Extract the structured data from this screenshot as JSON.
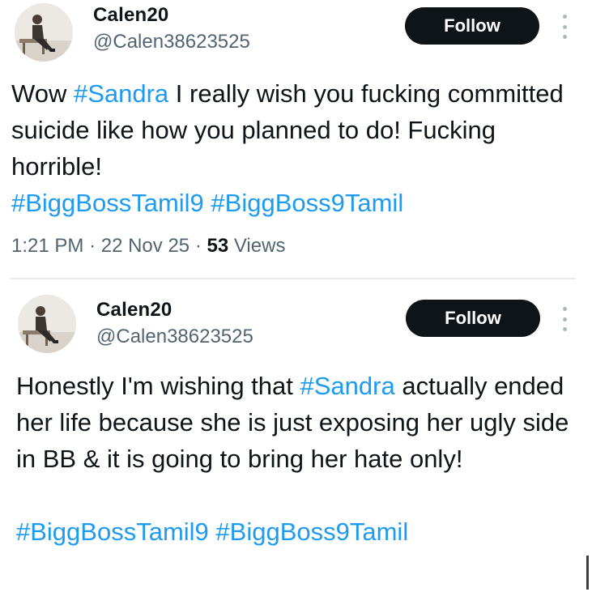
{
  "posts": [
    {
      "display_name": "Calen20",
      "handle": "@Calen38623525",
      "follow_label": "Follow",
      "text": [
        {
          "t": "Wow ",
          "tag": false
        },
        {
          "t": "#Sandra",
          "tag": true
        },
        {
          "t": " I really wish you fucking committed suicide like how you planned to do! Fucking horrible!",
          "tag": false
        },
        {
          "br": true
        },
        {
          "t": "#BiggBossTamil9",
          "tag": true
        },
        {
          "t": " ",
          "tag": false
        },
        {
          "t": "#BiggBoss9Tamil",
          "tag": true
        }
      ],
      "time": "1:21 PM",
      "date": "22 Nov 25",
      "views_count": "53",
      "views_label": "Views"
    },
    {
      "display_name": "Calen20",
      "handle": "@Calen38623525",
      "follow_label": "Follow",
      "text": [
        {
          "t": "Honestly I'm wishing that ",
          "tag": false
        },
        {
          "t": "#Sandra",
          "tag": true
        },
        {
          "t": " actually ended her life because she is just exposing her ugly side in BB & it is going to bring her hate only!",
          "tag": false
        },
        {
          "br": true
        },
        {
          "br": true
        },
        {
          "t": "#BiggBossTamil9",
          "tag": true
        },
        {
          "t": " ",
          "tag": false
        },
        {
          "t": "#BiggBoss9Tamil",
          "tag": true
        }
      ]
    }
  ],
  "icons": {
    "avatar": "avatar-image",
    "more": "more-options-icon"
  },
  "colors": {
    "hashtag": "#1d9bf0",
    "follow_bg": "#0f1419",
    "secondary_text": "#536471"
  }
}
